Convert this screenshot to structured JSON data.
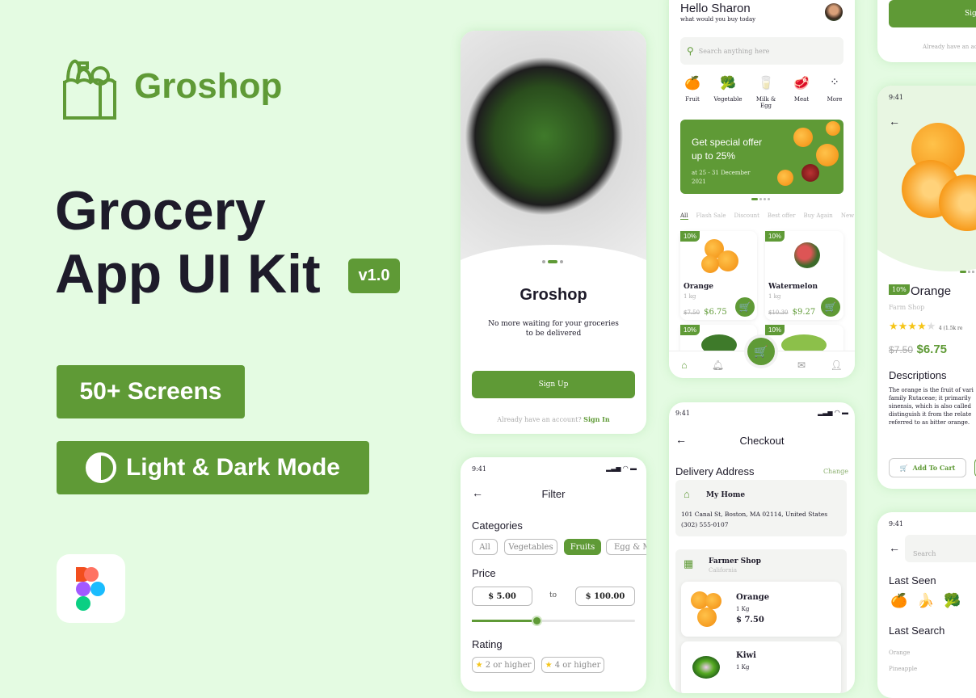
{
  "brand": {
    "name": "Groshop",
    "accent": "#5f9a36",
    "background": "#e4fbe2"
  },
  "hero": {
    "line1": "Grocery",
    "line2": "App UI Kit",
    "version": "v1.0",
    "feature1": "50+ Screens",
    "feature2": "Light & Dark Mode"
  },
  "onboarding": {
    "title": "Groshop",
    "subtitle1": "No more waiting for your groceries",
    "subtitle2": "to be delivered",
    "signup": "Sign Up",
    "have_account": "Already have an account?",
    "signin": "Sign In"
  },
  "filter": {
    "time": "9:41",
    "title": "Filter",
    "categories_label": "Categories",
    "categories": [
      "All",
      "Vegetables",
      "Fruits",
      "Egg & Me"
    ],
    "selected": "Fruits",
    "price_label": "Price",
    "min": "$ 5.00",
    "to": "to",
    "max": "$ 100.00",
    "slider_percent": 40,
    "rating_label": "Rating",
    "ratings": [
      "2 or higher",
      "4 or higher"
    ]
  },
  "home": {
    "greeting": "Hello Sharon",
    "sub": "what would you buy today",
    "search_placeholder": "Search anything here",
    "categories": [
      "Fruit",
      "Vegetable",
      "Milk & Egg",
      "Meat",
      "More"
    ],
    "banner": {
      "line1": "Get special offer",
      "line2": "up to 25%",
      "date1": "at 25 - 31 December",
      "date2": "2021"
    },
    "tabs": [
      "All",
      "Flash Sale",
      "Discount",
      "Best offer",
      "Buy Again",
      "New"
    ],
    "products": [
      {
        "badge": "10%",
        "name": "Orange",
        "unit": "1 kg",
        "old": "$7.50",
        "price": "$6.75"
      },
      {
        "badge": "10%",
        "name": "Watermelon",
        "unit": "1 kg",
        "old": "$10.30",
        "price": "$9.27"
      },
      {
        "badge": "10%"
      },
      {
        "badge": "10%"
      }
    ]
  },
  "checkout": {
    "time": "9:41",
    "title": "Checkout",
    "address_label": "Delivery Address",
    "change": "Change",
    "home_label": "My Home",
    "address": "101 Canal St, Boston, MA 02114, United States",
    "phone": "(302) 555-0107",
    "shop": "Farmer Shop",
    "shop_loc": "California",
    "items": [
      {
        "name": "Orange",
        "unit": "1 Kg",
        "price": "$ 7.50"
      },
      {
        "name": "Kiwi",
        "unit": "1 Kg"
      }
    ]
  },
  "signup_partial": {
    "button": "Sign Up",
    "have_account": "Already have an ac"
  },
  "product": {
    "time": "9:41",
    "badge": "10%",
    "name": "Orange",
    "shop": "Farm Shop",
    "rating": 4,
    "reviews": "4 (1.5k re",
    "old": "$7.50",
    "price": "$6.75",
    "desc_label": "Descriptions",
    "desc": [
      "The orange is the fruit of vari",
      "family Rutaceae; it primarily",
      "sinensis, which is also called",
      "distinguish it from the relate",
      "referred to as bitter orange."
    ],
    "add_to_cart": "Add To Cart"
  },
  "search": {
    "time": "9:41",
    "placeholder": "Search",
    "last_seen": "Last Seen",
    "last_search": "Last Search",
    "recent": [
      "Orange",
      "Pineapple"
    ]
  }
}
